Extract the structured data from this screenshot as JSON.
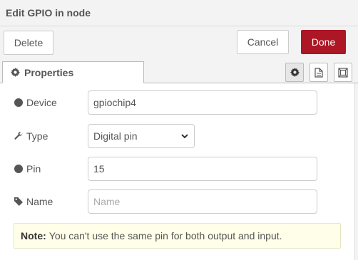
{
  "tray": {
    "title": "Edit GPIO in node"
  },
  "toolbar": {
    "delete_label": "Delete",
    "cancel_label": "Cancel",
    "done_label": "Done"
  },
  "tabs": {
    "properties_label": "Properties"
  },
  "tab_icons": [
    "settings-icon",
    "description-icon",
    "appearance-icon"
  ],
  "form": {
    "device": {
      "label": "Device",
      "value": "gpiochip4",
      "icon": "circle-icon"
    },
    "type": {
      "label": "Type",
      "value": "Digital pin",
      "icon": "wrench-icon"
    },
    "pin": {
      "label": "Pin",
      "value": "15",
      "icon": "circle-icon"
    },
    "name": {
      "label": "Name",
      "placeholder": "Name",
      "value": "",
      "icon": "tag-icon"
    }
  },
  "note": {
    "prefix": "Note:",
    "text": "You can't use the same pin for both output and input."
  },
  "colors": {
    "done_button": "#ad1625",
    "note_background": "#ffffe9",
    "background": "#f3f3f3"
  }
}
